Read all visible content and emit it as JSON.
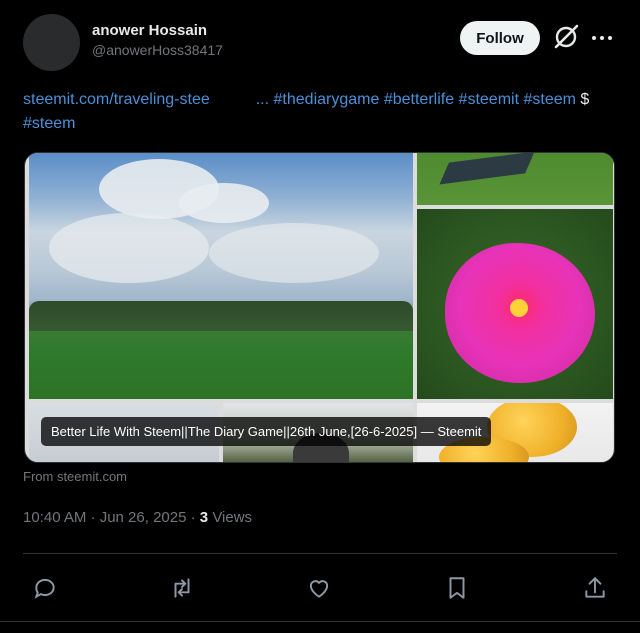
{
  "author": {
    "name": "anower Hossain",
    "handle": "@anowerHoss38417"
  },
  "header": {
    "follow_label": "Follow",
    "grok_icon": "grok-icon",
    "more_icon": "more-icon"
  },
  "post": {
    "link_text": "steemit.com/traveling-stee",
    "ellipsis": "...",
    "hashtags": [
      "#thediarygame",
      "#betterlife",
      "#steemit",
      "#steem"
    ],
    "dollar": "$",
    "cashtag": "#steem"
  },
  "card": {
    "title": "Better Life With Steem||The Diary Game||26th June,[26-6-2025] — Steemit",
    "source": "From steemit.com"
  },
  "meta": {
    "time": "10:40 AM · Jun 26, 2025",
    "separator": "·",
    "views_count": "3",
    "views_label": "Views"
  },
  "actions": [
    "reply-icon",
    "repost-icon",
    "like-icon",
    "bookmark-icon",
    "share-icon"
  ],
  "colors": {
    "background": "#000000",
    "link": "#4a90d9",
    "secondary_text": "#71767b",
    "follow_bg": "#eff3f4"
  }
}
